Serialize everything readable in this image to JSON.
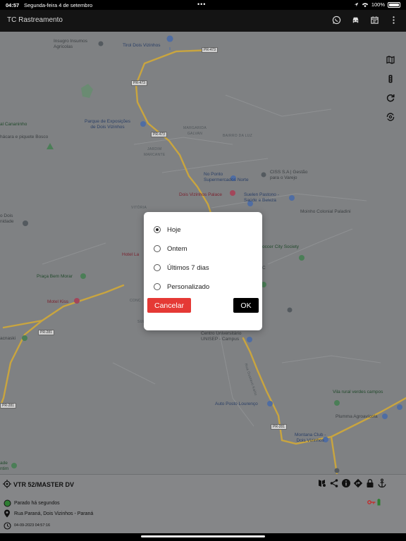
{
  "status_bar": {
    "time": "04:57",
    "date": "Segunda-feira 4 de setembro",
    "dots": "•••",
    "battery": "100%"
  },
  "app_bar": {
    "title": "TC Rastreamento",
    "icons": [
      "whatsapp-icon",
      "car-icon",
      "calendar-icon",
      "more-vert-icon"
    ]
  },
  "map": {
    "labels": {
      "insumos": "Insugro Insumos\nAgrícolas",
      "tirol": "Tirol Dois Vizinhos",
      "pr473a": "PR-473",
      "pr473b": "PR-473",
      "pr473c": "PR-473",
      "canhos": "al Cananinho",
      "chacara": "hácara e piquete Bosco",
      "parque": "Parque de Exposições\nde Dois Vizinhos",
      "margarida": "MARGARIDA\nGALVAN",
      "bairro_luz": "BAIRRO DA LUZ",
      "jardim": "JARDIM\nMARCANTE",
      "noponto": "No Ponto\nSupermercados Norte",
      "ciss": "CISS S.A | Gestão\npara o Varejo",
      "dv_palace": "Dois Vizinhos Palace",
      "suelen": "Suelen Pastono -\nSaúde e Beleza",
      "vitoria": "VITÓRIA",
      "moinho": "Moinho Colonial Paladini",
      "unidade": "o Dois\nnidade",
      "hotel": "Hotel La",
      "soccer": "occer City Society",
      "praca": "Praça Bem Morar",
      "motel": "Motel Kiss",
      "unisep": "Centro Universitário\nUNISEP - Campus",
      "pr281a": "PR-281",
      "pr281b": "PR-281",
      "pr281c": "PR-281",
      "macnaski": "acnaski",
      "vila": "Vila rural verdes campos",
      "plumma": "Plumma Agroavícola",
      "auto_posto": "Auto Posto Lourenço",
      "montana": "Montana Club -\nDois Vizinhos",
      "aude": "ade\nntim",
      "rua_gustavo": "Rua Gustavo Kalsc",
      "conc": "CONC",
      "sul": "SUL",
      "c": "C"
    }
  },
  "map_controls": [
    "map-layers-icon",
    "traffic-light-icon",
    "refresh-icon",
    "auto-refresh-icon"
  ],
  "dialog": {
    "options": [
      {
        "label": "Hoje",
        "selected": true
      },
      {
        "label": "Ontem",
        "selected": false
      },
      {
        "label": "Últimos 7 dias",
        "selected": false
      },
      {
        "label": "Personalizado",
        "selected": false
      }
    ],
    "cancel_label": "Cancelar",
    "ok_label": "OK",
    "cancel_color": "#e53935",
    "ok_color": "#000000"
  },
  "vehicle_panel": {
    "name": "VTR 52/MASTER DV",
    "status": "Parado há segundos",
    "address": "Rua Paraná, Dois Vizinhos - Paraná",
    "timestamp": "04-09-2023 04:57:16",
    "actions": [
      "route-icon",
      "share-icon",
      "info-icon",
      "directions-icon",
      "lock-icon",
      "anchor-icon"
    ],
    "status_color": "#2e7d32"
  }
}
